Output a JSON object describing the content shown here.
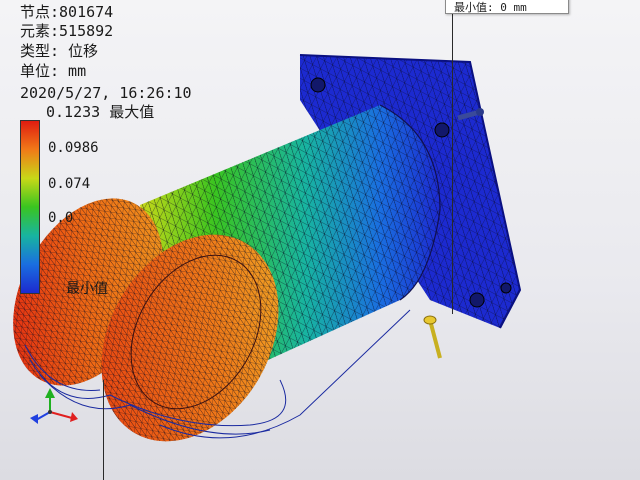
{
  "info": {
    "node": "节点:801674",
    "element": "元素:515892",
    "type": "类型: 位移",
    "unit": "单位: mm",
    "datetime": "2020/5/27, 16:26:10"
  },
  "legend": {
    "max_label": "0.1233 最大值",
    "tick_1": "0.0986",
    "tick_2": "0.074",
    "tick_3": "0.0",
    "min_label": "最小值",
    "colors": [
      "#e01c10",
      "#f07a18",
      "#c8d818",
      "#3ac420",
      "#18b4a0",
      "#1a6ee0",
      "#1c2ad0"
    ]
  },
  "tooltip": {
    "text": "最小值: 0 mm"
  },
  "axis_colors": {
    "x": "#e02020",
    "y": "#20b020",
    "z": "#2040e0"
  }
}
